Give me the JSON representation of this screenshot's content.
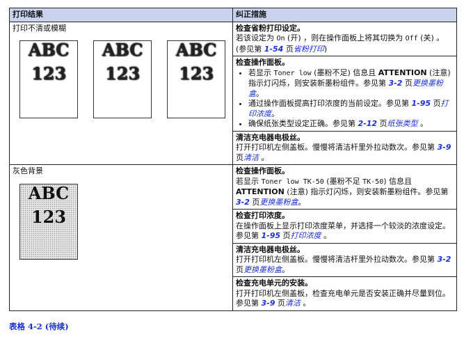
{
  "table": {
    "col1_header": "打印结果",
    "col2_header": "纠正措施",
    "row1": {
      "label": "打印不清或模糊",
      "samples": [
        {
          "line1": "ABC",
          "line2": "123"
        },
        {
          "line1": "ABC",
          "line2": "123"
        },
        {
          "line1": "ABC",
          "line2": "123"
        }
      ],
      "a1_title": "检查省粉打印设定。",
      "a1_t1": "若该设定为 ",
      "a1_on": "On",
      "a1_t2": " (开) ，则在操作面板上将其切换为 ",
      "a1_off": "Off",
      "a1_t3": " (关) 。(参见第 ",
      "a1_ref": "1-54",
      "a1_t4": " 页",
      "a1_link": "省粉打印",
      "a1_t5": ")",
      "a2_title": "检查操作面板。",
      "a2_b1_t1": "若显示 ",
      "a2_b1_mono": "Toner low",
      "a2_b1_t2": " (墨粉不足) 信息且 ",
      "a2_b1_attn": "ATTENTION",
      "a2_b1_t3": " (注意) 指示灯闪烁，则安装新墨粉组件。参见第 ",
      "a2_b1_ref": "3-2",
      "a2_b1_t4": " 页",
      "a2_b1_link": "更换墨粉盒",
      "a2_b1_t5": "。",
      "a2_b2_t1": "通过操作面板提高打印浓度的当前设定。参见第 ",
      "a2_b2_ref": "1-95",
      "a2_b2_t2": " 页",
      "a2_b2_link": "打印浓度",
      "a2_b2_t3": "。",
      "a2_b3_t1": "确保纸张类型设定正确。参见第 ",
      "a2_b3_ref": "2-12",
      "a2_b3_t2": " 页",
      "a2_b3_link": "纸张类型",
      "a2_b3_t3": " 。",
      "a3_title": "清洁充电器电极丝。",
      "a3_t1": "打开打印机左侧盖板。慢慢将清洁杆里外拉动数次。参见第 ",
      "a3_ref": "3-9",
      "a3_t2": " 页",
      "a3_link": "清洁",
      "a3_t3": " 。"
    },
    "row2": {
      "label": "灰色背景",
      "sample": {
        "line1": "ABC",
        "line2": "123"
      },
      "b1_title": "检查操作面板。",
      "b1_t1": "若显示 ",
      "b1_mono": "Toner low TK-50",
      "b1_t2": " (墨粉不足 ",
      "b1_mono2": "TK-50",
      "b1_t3": ") 信息且 ",
      "b1_attn": "ATTENTION",
      "b1_t4": " (注意) 指示灯闪烁，则安装新墨粉组件。参见第 ",
      "b1_ref": "3-2",
      "b1_t5": " 页",
      "b1_link": "更换墨粉盒",
      "b1_t6": "。",
      "b2_title": "检查打印浓度。",
      "b2_t1": "在操作面板上显示打印浓度菜单，并选择一个较淡的浓度设定。参见第 ",
      "b2_ref": "1-95",
      "b2_t2": " 页",
      "b2_link": "打印浓度",
      "b2_t3": " 。",
      "b3_title": "清洁充电器电极丝。",
      "b3_t1": "打开打印机左侧盖板。慢慢将清洁杆里外拉动数次。参见第 ",
      "b3_ref": "3-2",
      "b3_t2": " 页",
      "b3_link": "更换墨粉盒",
      "b3_t3": "。",
      "b4_title": "检查充电单元的安装。",
      "b4_t1": "打开打印机左侧盖板，检查充电单元是否安装正确并尽量到位。参见第 ",
      "b4_ref": "3-9",
      "b4_t2": " 页",
      "b4_link": "清洁",
      "b4_t3": " 。"
    }
  },
  "caption": "表格 4-2   (待续)"
}
